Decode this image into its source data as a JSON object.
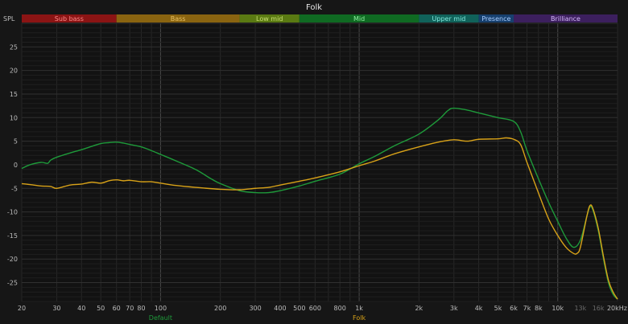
{
  "chart_data": {
    "type": "line",
    "title": "Folk",
    "ylabel": "SPL",
    "xscale": "log",
    "xlim": [
      20,
      20000
    ],
    "ylim": [
      -29,
      30
    ],
    "grid": true,
    "y_ticks": [
      25,
      20,
      15,
      10,
      5,
      0,
      -5,
      -10,
      -15,
      -20,
      -25
    ],
    "x_ticks": [
      {
        "v": 20,
        "label": "20"
      },
      {
        "v": 30,
        "label": "30"
      },
      {
        "v": 40,
        "label": "40"
      },
      {
        "v": 50,
        "label": "50"
      },
      {
        "v": 60,
        "label": "60"
      },
      {
        "v": 70,
        "label": "70"
      },
      {
        "v": 80,
        "label": "80"
      },
      {
        "v": 100,
        "label": "100"
      },
      {
        "v": 200,
        "label": "200"
      },
      {
        "v": 300,
        "label": "300"
      },
      {
        "v": 400,
        "label": "400"
      },
      {
        "v": 500,
        "label": "500"
      },
      {
        "v": 600,
        "label": "600"
      },
      {
        "v": 800,
        "label": "800"
      },
      {
        "v": 1000,
        "label": "1k"
      },
      {
        "v": 2000,
        "label": "2k"
      },
      {
        "v": 3000,
        "label": "3k"
      },
      {
        "v": 4000,
        "label": "4k"
      },
      {
        "v": 5000,
        "label": "5k"
      },
      {
        "v": 6000,
        "label": "6k"
      },
      {
        "v": 7000,
        "label": "7k"
      },
      {
        "v": 8000,
        "label": "8k"
      },
      {
        "v": 10000,
        "label": "10k"
      },
      {
        "v": 13000,
        "label": "13k",
        "dim": true
      },
      {
        "v": 16000,
        "label": "16k",
        "dim": true
      },
      {
        "v": 20000,
        "label": "20kHz"
      }
    ],
    "bands": [
      {
        "name": "Sub bass",
        "from": 20,
        "to": 60,
        "color": "#8b1414",
        "text": "#ff8a8a"
      },
      {
        "name": "Bass",
        "from": 60,
        "to": 250,
        "color": "#8a6410",
        "text": "#e8c060"
      },
      {
        "name": "Low mid",
        "from": 250,
        "to": 500,
        "color": "#5a7a12",
        "text": "#c8e070"
      },
      {
        "name": "Mid",
        "from": 500,
        "to": 2000,
        "color": "#0f6a22",
        "text": "#8ef0a0"
      },
      {
        "name": "Upper mid",
        "from": 2000,
        "to": 4000,
        "color": "#10625a",
        "text": "#80e8dc"
      },
      {
        "name": "Presence",
        "from": 4000,
        "to": 6000,
        "color": "#17406e",
        "text": "#a8ccff"
      },
      {
        "name": "Brilliance",
        "from": 6000,
        "to": 20000,
        "color": "#3c1f5e",
        "text": "#d8b8ff"
      }
    ],
    "series": [
      {
        "name": "Default",
        "color": "#1e9a3a",
        "points": [
          [
            20,
            -0.8
          ],
          [
            22,
            0
          ],
          [
            25,
            0.5
          ],
          [
            27,
            0.3
          ],
          [
            28,
            1.0
          ],
          [
            30,
            1.6
          ],
          [
            35,
            2.5
          ],
          [
            40,
            3.2
          ],
          [
            45,
            3.9
          ],
          [
            50,
            4.5
          ],
          [
            55,
            4.7
          ],
          [
            60,
            4.8
          ],
          [
            65,
            4.6
          ],
          [
            70,
            4.3
          ],
          [
            80,
            3.8
          ],
          [
            90,
            3.0
          ],
          [
            100,
            2.2
          ],
          [
            120,
            0.8
          ],
          [
            150,
            -1.0
          ],
          [
            180,
            -3.0
          ],
          [
            200,
            -4.0
          ],
          [
            250,
            -5.5
          ],
          [
            300,
            -5.9
          ],
          [
            350,
            -5.9
          ],
          [
            400,
            -5.5
          ],
          [
            500,
            -4.5
          ],
          [
            600,
            -3.5
          ],
          [
            800,
            -2.0
          ],
          [
            1000,
            0.2
          ],
          [
            1200,
            1.8
          ],
          [
            1500,
            4.0
          ],
          [
            2000,
            6.5
          ],
          [
            2500,
            9.5
          ],
          [
            2800,
            11.5
          ],
          [
            3000,
            12.0
          ],
          [
            3500,
            11.6
          ],
          [
            4000,
            11.0
          ],
          [
            5000,
            10.0
          ],
          [
            6000,
            9.2
          ],
          [
            6500,
            7.0
          ],
          [
            7000,
            3.0
          ],
          [
            8000,
            -3.0
          ],
          [
            9000,
            -8.0
          ],
          [
            10000,
            -12.0
          ],
          [
            11000,
            -15.5
          ],
          [
            12000,
            -17.5
          ],
          [
            13000,
            -16.0
          ],
          [
            14000,
            -11.0
          ],
          [
            14500,
            -9.0
          ],
          [
            15000,
            -9.5
          ],
          [
            16000,
            -14.0
          ],
          [
            17000,
            -20.0
          ],
          [
            18000,
            -25.0
          ],
          [
            19000,
            -27.5
          ],
          [
            20000,
            -28.5
          ]
        ]
      },
      {
        "name": "Folk",
        "color": "#d8a218",
        "points": [
          [
            20,
            -4.0
          ],
          [
            22,
            -4.2
          ],
          [
            25,
            -4.5
          ],
          [
            28,
            -4.6
          ],
          [
            30,
            -5.0
          ],
          [
            35,
            -4.3
          ],
          [
            40,
            -4.1
          ],
          [
            45,
            -3.7
          ],
          [
            50,
            -3.9
          ],
          [
            55,
            -3.4
          ],
          [
            60,
            -3.2
          ],
          [
            65,
            -3.4
          ],
          [
            70,
            -3.3
          ],
          [
            80,
            -3.6
          ],
          [
            90,
            -3.6
          ],
          [
            100,
            -3.9
          ],
          [
            120,
            -4.4
          ],
          [
            150,
            -4.8
          ],
          [
            200,
            -5.2
          ],
          [
            250,
            -5.3
          ],
          [
            300,
            -5.0
          ],
          [
            350,
            -4.8
          ],
          [
            400,
            -4.3
          ],
          [
            500,
            -3.5
          ],
          [
            600,
            -2.8
          ],
          [
            800,
            -1.5
          ],
          [
            1000,
            -0.2
          ],
          [
            1200,
            0.8
          ],
          [
            1500,
            2.3
          ],
          [
            2000,
            3.8
          ],
          [
            2500,
            4.8
          ],
          [
            3000,
            5.3
          ],
          [
            3500,
            5.0
          ],
          [
            4000,
            5.4
          ],
          [
            5000,
            5.5
          ],
          [
            5500,
            5.7
          ],
          [
            6000,
            5.4
          ],
          [
            6500,
            4.3
          ],
          [
            7000,
            0.5
          ],
          [
            8000,
            -6.0
          ],
          [
            9000,
            -11.5
          ],
          [
            10000,
            -15.0
          ],
          [
            11000,
            -17.5
          ],
          [
            12000,
            -18.8
          ],
          [
            12500,
            -18.8
          ],
          [
            13000,
            -17.5
          ],
          [
            14000,
            -11.0
          ],
          [
            14500,
            -8.7
          ],
          [
            15000,
            -9.2
          ],
          [
            16000,
            -13.5
          ],
          [
            17000,
            -19.5
          ],
          [
            18000,
            -24.5
          ],
          [
            19000,
            -27.0
          ],
          [
            20000,
            -28.5
          ]
        ]
      }
    ]
  }
}
